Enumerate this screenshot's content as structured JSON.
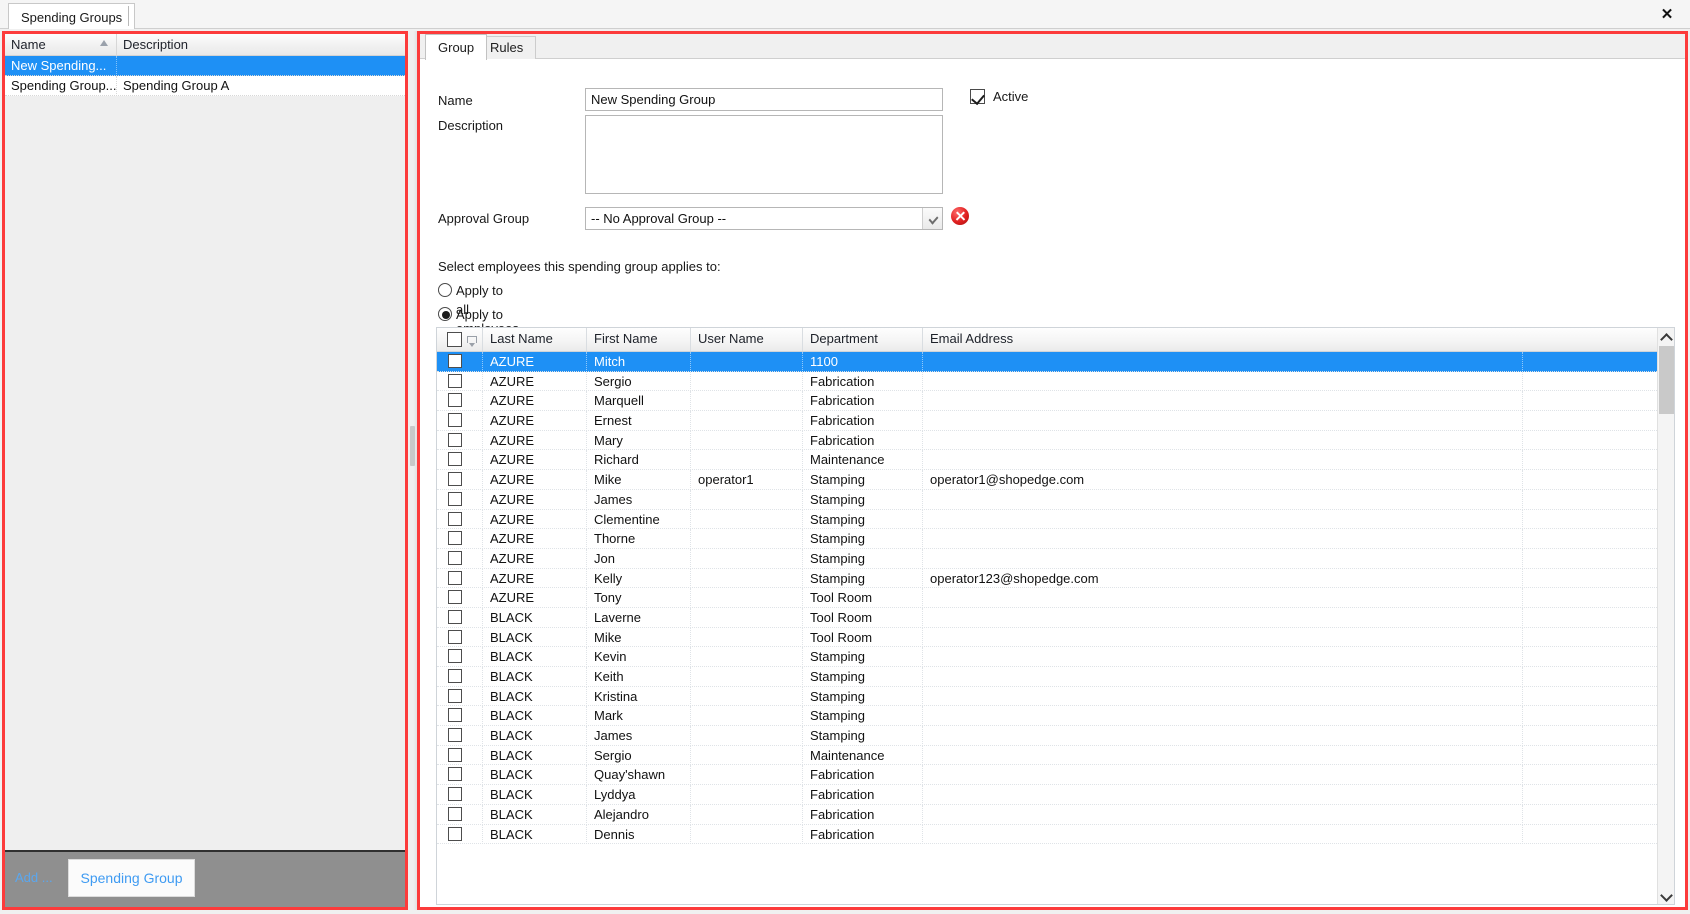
{
  "window": {
    "document_tab": "Spending Groups",
    "close_label": "✕"
  },
  "left_panel": {
    "columns": [
      "Name",
      "Description"
    ],
    "rows": [
      {
        "name": "New  Spending...",
        "description": "",
        "selected": true
      },
      {
        "name": "Spending  Group...",
        "description": "Spending Group A",
        "selected": false
      }
    ],
    "footer": {
      "add_label": "Add ...",
      "add_button_label": "Spending Group"
    }
  },
  "right_panel": {
    "tabs": [
      {
        "label": "Group",
        "active": true
      },
      {
        "label": "Rules",
        "active": false
      }
    ],
    "form": {
      "name_label": "Name",
      "name_value": "New Spending Group",
      "description_label": "Description",
      "description_value": "",
      "description_placeholder": "",
      "approval_group_label": "Approval Group",
      "approval_group_value": "-- No Approval Group --",
      "active_label": "Active",
      "active_checked": true,
      "clear_approval_icon": "delete-circle-icon"
    },
    "employee_selection": {
      "hint": "Select employees this spending group applies to:",
      "option_all": "Apply to all employees",
      "option_selected": "Apply to selected employees",
      "selected_option": "Apply to selected employees"
    },
    "employee_table": {
      "columns": [
        "",
        "Last Name",
        "First Name",
        "User Name",
        "Department",
        "Email Address"
      ],
      "rows": [
        {
          "checked": false,
          "last": "AZURE",
          "first": "Mitch",
          "user": "",
          "dept": "1100",
          "email": "",
          "selected": true
        },
        {
          "checked": false,
          "last": "AZURE",
          "first": "Sergio",
          "user": "",
          "dept": "Fabrication",
          "email": "",
          "selected": false
        },
        {
          "checked": false,
          "last": "AZURE",
          "first": "Marquell",
          "user": "",
          "dept": "Fabrication",
          "email": "",
          "selected": false
        },
        {
          "checked": false,
          "last": "AZURE",
          "first": "Ernest",
          "user": "",
          "dept": "Fabrication",
          "email": "",
          "selected": false
        },
        {
          "checked": false,
          "last": "AZURE",
          "first": "Mary",
          "user": "",
          "dept": "Fabrication",
          "email": "",
          "selected": false
        },
        {
          "checked": false,
          "last": "AZURE",
          "first": "Richard",
          "user": "",
          "dept": "Maintenance",
          "email": "",
          "selected": false
        },
        {
          "checked": false,
          "last": "AZURE",
          "first": "Mike",
          "user": "operator1",
          "dept": "Stamping",
          "email": "operator1@shopedge.com",
          "selected": false
        },
        {
          "checked": false,
          "last": "AZURE",
          "first": "James",
          "user": "",
          "dept": "Stamping",
          "email": "",
          "selected": false
        },
        {
          "checked": false,
          "last": "AZURE",
          "first": "Clementine",
          "user": "",
          "dept": "Stamping",
          "email": "",
          "selected": false
        },
        {
          "checked": false,
          "last": "AZURE",
          "first": "Thorne",
          "user": "",
          "dept": "Stamping",
          "email": "",
          "selected": false
        },
        {
          "checked": false,
          "last": "AZURE",
          "first": "Jon",
          "user": "",
          "dept": "Stamping",
          "email": "",
          "selected": false
        },
        {
          "checked": false,
          "last": "AZURE",
          "first": "Kelly",
          "user": "",
          "dept": "Stamping",
          "email": "operator123@shopedge.com",
          "selected": false
        },
        {
          "checked": false,
          "last": "AZURE",
          "first": "Tony",
          "user": "",
          "dept": "Tool Room",
          "email": "",
          "selected": false
        },
        {
          "checked": false,
          "last": "BLACK",
          "first": "Laverne",
          "user": "",
          "dept": "Tool Room",
          "email": "",
          "selected": false
        },
        {
          "checked": false,
          "last": "BLACK",
          "first": "Mike",
          "user": "",
          "dept": "Tool Room",
          "email": "",
          "selected": false
        },
        {
          "checked": false,
          "last": "BLACK",
          "first": "Kevin",
          "user": "",
          "dept": "Stamping",
          "email": "",
          "selected": false
        },
        {
          "checked": false,
          "last": "BLACK",
          "first": "Keith",
          "user": "",
          "dept": "Stamping",
          "email": "",
          "selected": false
        },
        {
          "checked": false,
          "last": "BLACK",
          "first": "Kristina",
          "user": "",
          "dept": "Stamping",
          "email": "",
          "selected": false
        },
        {
          "checked": false,
          "last": "BLACK",
          "first": "Mark",
          "user": "",
          "dept": "Stamping",
          "email": "",
          "selected": false
        },
        {
          "checked": false,
          "last": "BLACK",
          "first": "James",
          "user": "",
          "dept": "Stamping",
          "email": "",
          "selected": false
        },
        {
          "checked": false,
          "last": "BLACK",
          "first": "Sergio",
          "user": "",
          "dept": "Maintenance",
          "email": "",
          "selected": false
        },
        {
          "checked": false,
          "last": "BLACK",
          "first": "Quay'shawn",
          "user": "",
          "dept": "Fabrication",
          "email": "",
          "selected": false
        },
        {
          "checked": false,
          "last": "BLACK",
          "first": "Lyddya",
          "user": "",
          "dept": "Fabrication",
          "email": "",
          "selected": false
        },
        {
          "checked": false,
          "last": "BLACK",
          "first": "Alejandro",
          "user": "",
          "dept": "Fabrication",
          "email": "",
          "selected": false
        },
        {
          "checked": false,
          "last": "BLACK",
          "first": "Dennis",
          "user": "",
          "dept": "Fabrication",
          "email": "",
          "selected": false
        }
      ]
    }
  },
  "colors": {
    "selection_blue": "#1e90f5",
    "highlight_red": "#fc3b3b",
    "link_blue": "#5aa7ef",
    "footer_gray": "#8f8f8f",
    "delete_red": "#e02020"
  }
}
